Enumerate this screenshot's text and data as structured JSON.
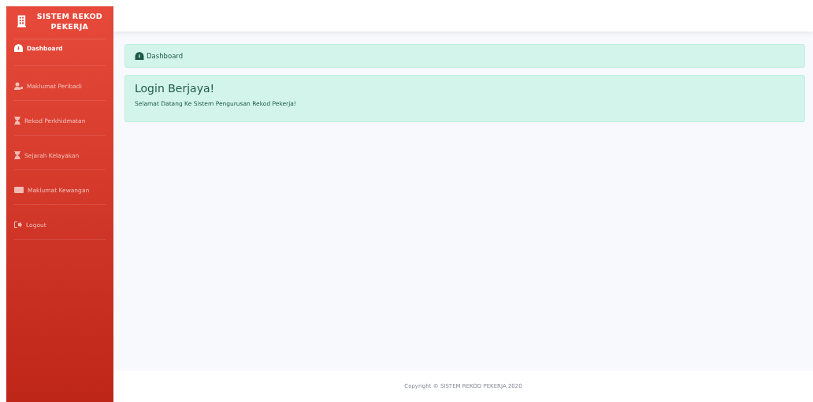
{
  "brand": {
    "title": "SISTEM REKOD PEKERJA"
  },
  "sidebar": {
    "items": [
      {
        "label": "Dashboard",
        "kind": "gauge",
        "selected": true
      },
      {
        "label": "Maklumat Peribadi",
        "kind": "user",
        "selected": false
      },
      {
        "label": "Rekod Perkhidmatan",
        "kind": "hourglass",
        "selected": false
      },
      {
        "label": "Sejarah Kelayakan",
        "kind": "hourglass",
        "selected": false
      },
      {
        "label": "Maklumat Kewangan",
        "kind": "card",
        "selected": false
      },
      {
        "label": "Logout",
        "kind": "logout",
        "selected": false
      }
    ]
  },
  "breadcrumb": {
    "label": "Dashboard"
  },
  "alert": {
    "title": "Login Berjaya!",
    "message": "Selamat Datang Ke Sistem Pengurusan Rekod Pekerja!"
  },
  "footer": {
    "text": "Copyright © SISTEM REKOD PEKERJA 2020"
  }
}
